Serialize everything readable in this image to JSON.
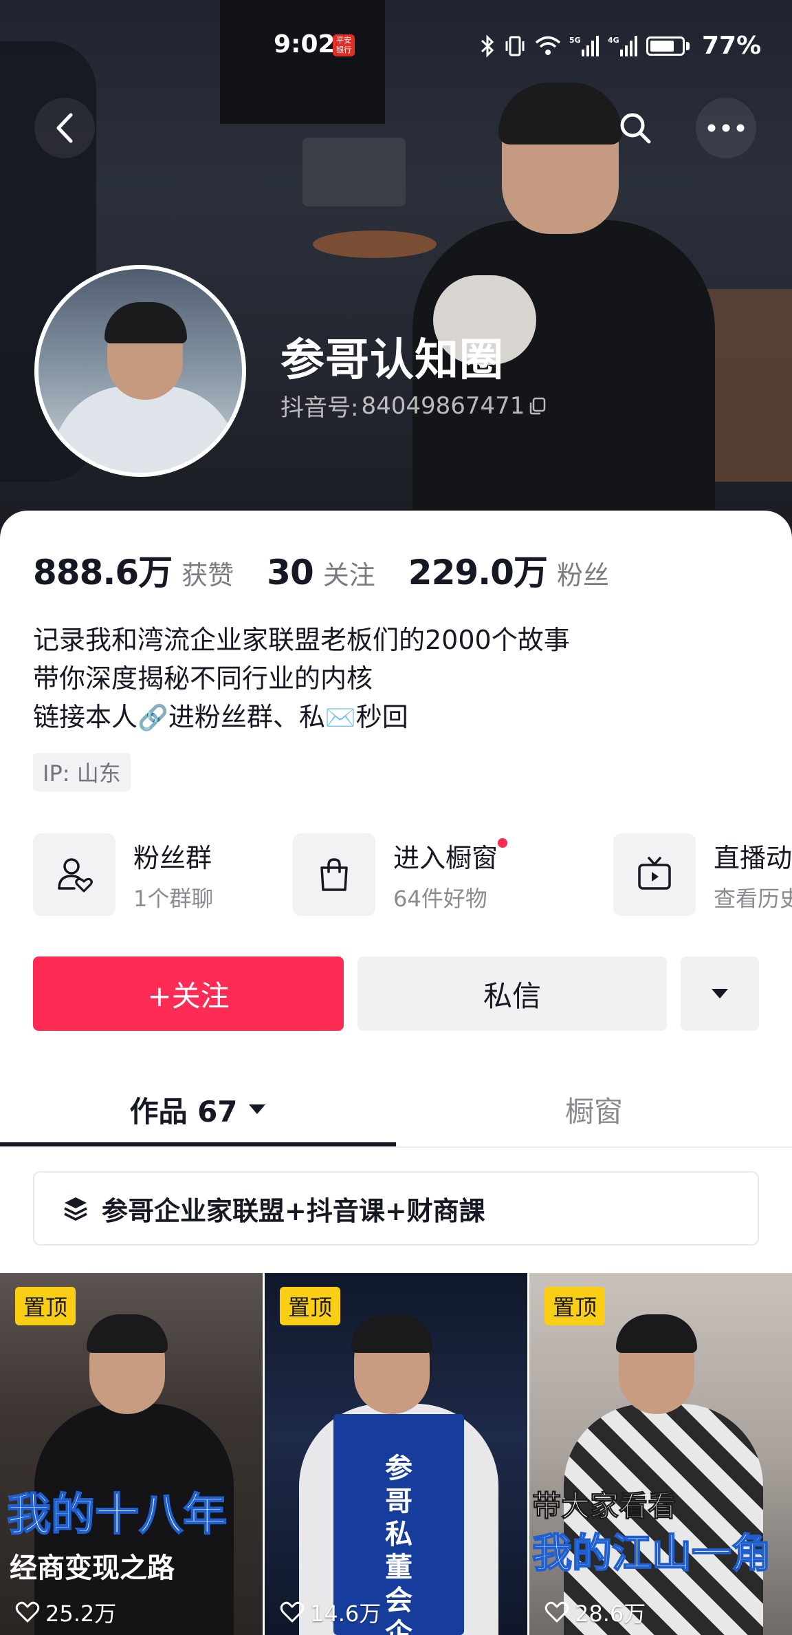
{
  "status_bar": {
    "time": "9:02",
    "app_badge": "平安银行",
    "battery_percent": "77%",
    "network_labels": [
      "5G",
      "4G"
    ]
  },
  "header": {
    "nickname": "参哥认知圈",
    "douyin_id_label": "抖音号:",
    "douyin_id": "84049867471"
  },
  "stats": {
    "likes_value": "888.6万",
    "likes_label": "获赞",
    "following_value": "30",
    "following_label": "关注",
    "followers_value": "229.0万",
    "followers_label": "粉丝"
  },
  "bio": {
    "line1": "记录我和湾流企业家联盟老板们的2000个故事",
    "line2": "带你深度揭秘不同行业的内核",
    "line3_a": "链接本人",
    "line3_emoji1": "🔗",
    "line3_b": "进粉丝群、私",
    "line3_emoji2": "✉️",
    "line3_c": "秒回"
  },
  "ip_tag": "IP:  山东",
  "entries": [
    {
      "title": "粉丝群",
      "sub": "1个群聊",
      "icon": "fans-group-icon"
    },
    {
      "title": "进入橱窗",
      "sub": "64件好物",
      "icon": "shopping-bag-icon",
      "has_red_dot": true
    },
    {
      "title": "直播动态",
      "sub": "查看历史",
      "icon": "live-tv-icon"
    }
  ],
  "actions": {
    "follow_label": "+关注",
    "message_label": "私信"
  },
  "tabs": {
    "works_label": "作品 67",
    "shop_label": "橱窗"
  },
  "collection_label": "参哥企业家联盟+抖音课+财商課",
  "videos": [
    {
      "pin": "置顶",
      "caption_main": "我的十八年",
      "caption_sub": "经商变现之路",
      "likes": "25.2万"
    },
    {
      "pin": "置顶",
      "caption_vertical": "参哥私董会企服季",
      "likes": "14.6万"
    },
    {
      "pin": "置顶",
      "caption_sub": "带大家看看",
      "caption_main": "我的江山一角",
      "likes": "28.6万"
    }
  ],
  "colors": {
    "accent_red": "#fe2c55",
    "pin_yellow": "#face15",
    "text_primary": "#161823",
    "text_secondary": "#8a8b91"
  }
}
